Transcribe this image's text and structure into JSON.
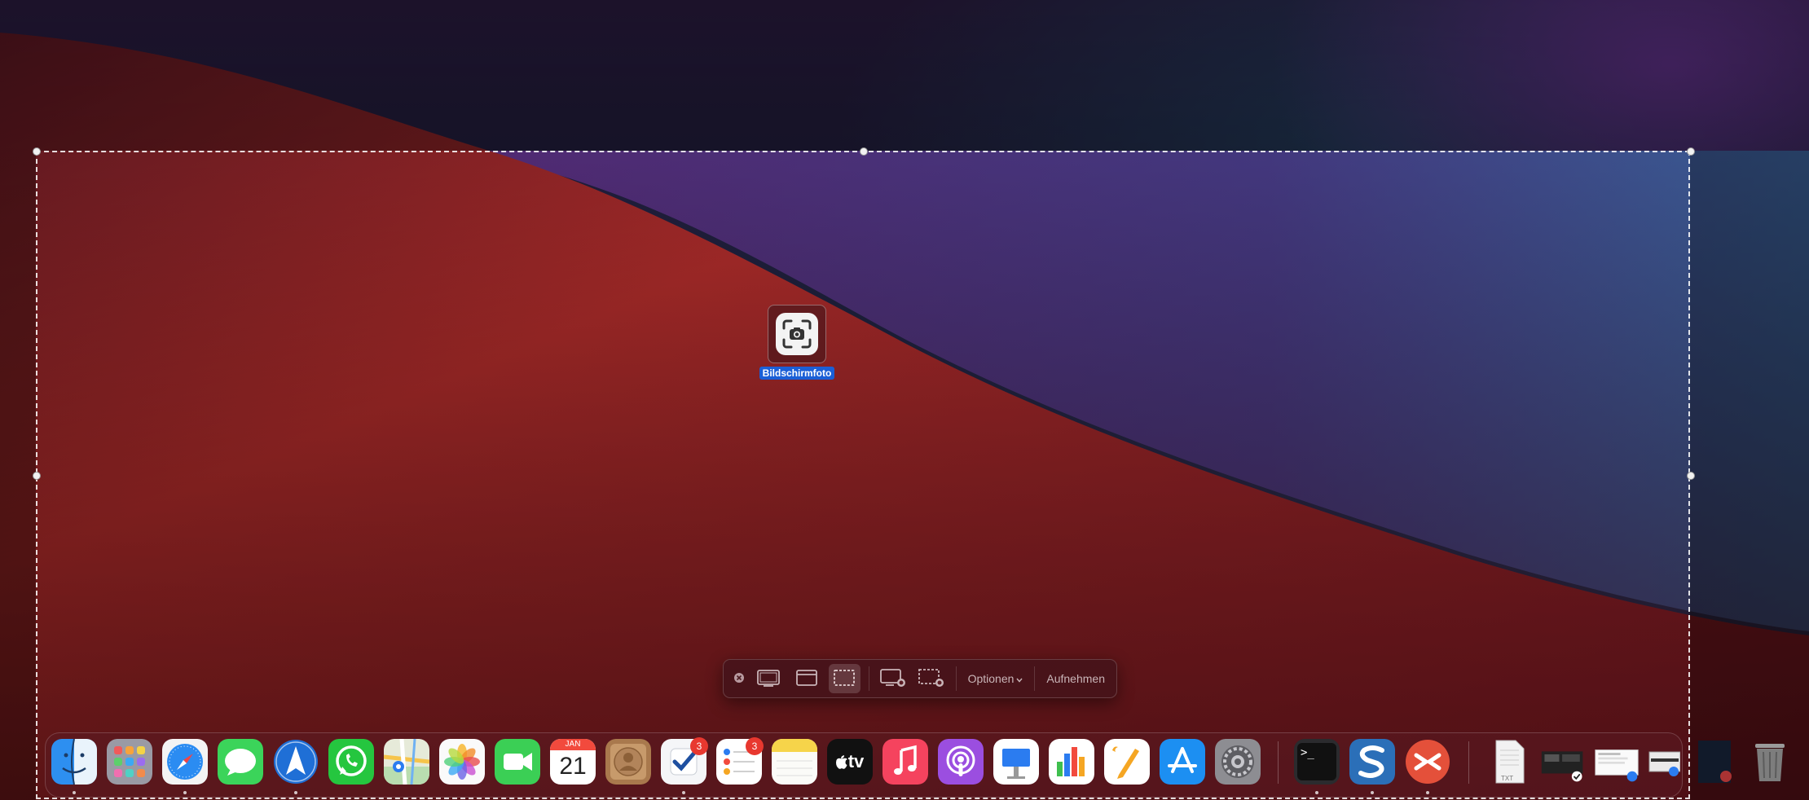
{
  "desktop": {
    "icon_label": "Bildschirmfoto",
    "icon_name": "screenshot-app-icon"
  },
  "toolbar": {
    "close_icon": "close-icon",
    "capture_screen_icon": "capture-screen-icon",
    "capture_window_icon": "capture-window-icon",
    "capture_selection_icon": "capture-selection-icon",
    "record_screen_icon": "record-screen-icon",
    "record_selection_icon": "record-selection-icon",
    "options_label": "Optionen",
    "capture_label": "Aufnehmen"
  },
  "dock": {
    "apps": [
      {
        "name": "Finder",
        "icon": "finder-icon"
      },
      {
        "name": "Launchpad",
        "icon": "launchpad-icon"
      },
      {
        "name": "Safari",
        "icon": "safari-icon"
      },
      {
        "name": "Nachrichten",
        "icon": "messages-icon"
      },
      {
        "name": "Spark",
        "icon": "spark-icon"
      },
      {
        "name": "WhatsApp",
        "icon": "whatsapp-icon"
      },
      {
        "name": "Karten",
        "icon": "maps-icon"
      },
      {
        "name": "Fotos",
        "icon": "photos-icon"
      },
      {
        "name": "FaceTime",
        "icon": "facetime-icon"
      },
      {
        "name": "Kalender",
        "icon": "calendar-icon",
        "month": "JAN",
        "day": "21"
      },
      {
        "name": "Kontakte",
        "icon": "contacts-icon"
      },
      {
        "name": "Things",
        "icon": "things-icon",
        "badge": "3"
      },
      {
        "name": "Erinnerungen",
        "icon": "reminders-icon",
        "badge": "3"
      },
      {
        "name": "Notizen",
        "icon": "notes-icon"
      },
      {
        "name": "TV",
        "icon": "apple-tv-icon",
        "text": "tv"
      },
      {
        "name": "Musik",
        "icon": "music-icon"
      },
      {
        "name": "Podcasts",
        "icon": "podcasts-icon"
      },
      {
        "name": "Keynote",
        "icon": "keynote-icon"
      },
      {
        "name": "Numbers",
        "icon": "numbers-icon"
      },
      {
        "name": "Pages",
        "icon": "pages-icon"
      },
      {
        "name": "App Store",
        "icon": "app-store-icon"
      },
      {
        "name": "Systemeinstellungen",
        "icon": "system-preferences-icon"
      },
      {
        "name": "Terminal",
        "icon": "terminal-icon",
        "text": ">_"
      },
      {
        "name": "Scrivener",
        "icon": "scrivener-icon"
      },
      {
        "name": "Remote Desktop",
        "icon": "remote-desktop-icon"
      }
    ],
    "stack_txt_label": "TXT"
  }
}
